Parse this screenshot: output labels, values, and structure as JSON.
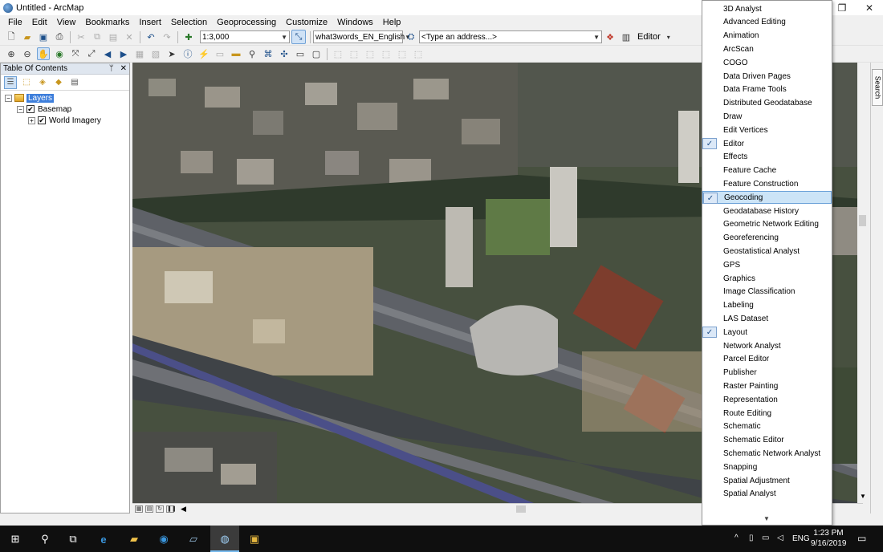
{
  "window": {
    "title": "Untitled - ArcMap",
    "minimize": "—",
    "restore": "❐",
    "close": "✕"
  },
  "menus": [
    "File",
    "Edit",
    "View",
    "Bookmarks",
    "Insert",
    "Selection",
    "Geoprocessing",
    "Customize",
    "Windows",
    "Help"
  ],
  "toolbar": {
    "scale": "1:3,000",
    "locator": "what3words_EN_English",
    "address_placeholder": "<Type an address...>",
    "editor_label": "Editor"
  },
  "toc": {
    "title": "Table Of Contents",
    "pin": "ᛘ",
    "close": "✕",
    "layers_label": "Layers",
    "basemap_label": "Basemap",
    "world_imagery_label": "World Imagery",
    "collapse_symbol": "−",
    "check_symbol": "✔"
  },
  "search_rail": {
    "label": "Search"
  },
  "toolbars_menu": {
    "items": [
      {
        "label": "3D Analyst",
        "checked": false
      },
      {
        "label": "Advanced Editing",
        "checked": false
      },
      {
        "label": "Animation",
        "checked": false
      },
      {
        "label": "ArcScan",
        "checked": false
      },
      {
        "label": "COGO",
        "checked": false
      },
      {
        "label": "Data Driven Pages",
        "checked": false
      },
      {
        "label": "Data Frame Tools",
        "checked": false
      },
      {
        "label": "Distributed Geodatabase",
        "checked": false
      },
      {
        "label": "Draw",
        "checked": false
      },
      {
        "label": "Edit Vertices",
        "checked": false
      },
      {
        "label": "Editor",
        "checked": true
      },
      {
        "label": "Effects",
        "checked": false
      },
      {
        "label": "Feature Cache",
        "checked": false
      },
      {
        "label": "Feature Construction",
        "checked": false
      },
      {
        "label": "Geocoding",
        "checked": true,
        "highlighted": true
      },
      {
        "label": "Geodatabase History",
        "checked": false
      },
      {
        "label": "Geometric Network Editing",
        "checked": false
      },
      {
        "label": "Georeferencing",
        "checked": false
      },
      {
        "label": "Geostatistical Analyst",
        "checked": false
      },
      {
        "label": "GPS",
        "checked": false
      },
      {
        "label": "Graphics",
        "checked": false
      },
      {
        "label": "Image Classification",
        "checked": false
      },
      {
        "label": "Labeling",
        "checked": false
      },
      {
        "label": "LAS Dataset",
        "checked": false
      },
      {
        "label": "Layout",
        "checked": true
      },
      {
        "label": "Network Analyst",
        "checked": false
      },
      {
        "label": "Parcel Editor",
        "checked": false
      },
      {
        "label": "Publisher",
        "checked": false
      },
      {
        "label": "Raster Painting",
        "checked": false
      },
      {
        "label": "Representation",
        "checked": false
      },
      {
        "label": "Route Editing",
        "checked": false
      },
      {
        "label": "Schematic",
        "checked": false
      },
      {
        "label": "Schematic Editor",
        "checked": false
      },
      {
        "label": "Schematic Network Analyst",
        "checked": false
      },
      {
        "label": "Snapping",
        "checked": false
      },
      {
        "label": "Spatial Adjustment",
        "checked": false
      },
      {
        "label": "Spatial Analyst",
        "checked": false
      }
    ],
    "check_glyph": "✓",
    "more_glyph": "▼"
  },
  "taskbar": {
    "language": "ENG",
    "time": "1:23 PM",
    "date": "9/16/2019"
  },
  "colors": {
    "selection_blue": "#3d7edb",
    "menu_highlight": "#cce4f7",
    "taskbar": "#0f0f0f"
  }
}
